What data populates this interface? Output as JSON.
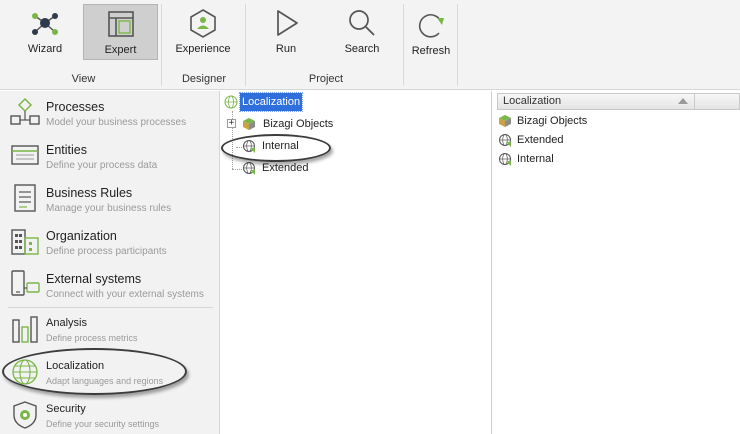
{
  "ribbon": {
    "groups": [
      {
        "label": "View"
      },
      {
        "label": "Designer"
      },
      {
        "label": "Project"
      }
    ],
    "buttons": {
      "wizard": "Wizard",
      "expert": "Expert",
      "experience": "Experience",
      "run": "Run",
      "search": "Search",
      "refresh": "Refresh"
    }
  },
  "nav": {
    "items": [
      {
        "title": "Processes",
        "subtitle": "Model your business processes"
      },
      {
        "title": "Entities",
        "subtitle": "Define your process data"
      },
      {
        "title": "Business Rules",
        "subtitle": "Manage your business rules"
      },
      {
        "title": "Organization",
        "subtitle": "Define process participants"
      },
      {
        "title": "External systems",
        "subtitle": "Connect with your external systems"
      },
      {
        "title": "Analysis",
        "subtitle": "Define process metrics"
      },
      {
        "title": "Localization",
        "subtitle": "Adapt languages and regions"
      },
      {
        "title": "Security",
        "subtitle": "Define your security settings"
      }
    ]
  },
  "tree": {
    "root": "Localization",
    "children": [
      {
        "label": "Bizagi Objects",
        "expander": "+"
      },
      {
        "label": "Internal"
      },
      {
        "label": "Extended"
      }
    ]
  },
  "list": {
    "column_header": "Localization",
    "items": [
      {
        "label": "Bizagi Objects",
        "icon": "bizagi-objects-icon"
      },
      {
        "label": "Extended",
        "icon": "globe-arrow-icon"
      },
      {
        "label": "Internal",
        "icon": "globe-arrow-icon"
      }
    ]
  },
  "colors": {
    "accent_green": "#7ab648",
    "selection_blue": "#2f6fdc",
    "ribbon_bg": "#f3f3f3",
    "nav_bg": "#f2f2f2"
  }
}
